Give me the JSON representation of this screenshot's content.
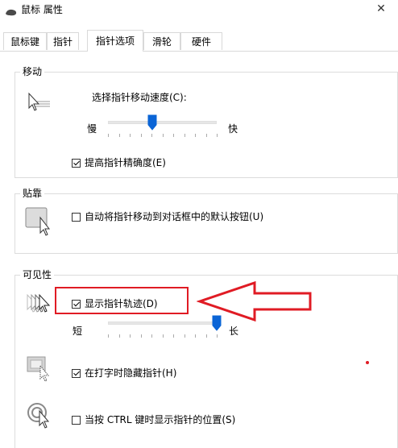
{
  "window": {
    "title": "鼠标 属性",
    "close_glyph": "✕"
  },
  "tabs": [
    {
      "label": "鼠标键",
      "active": false
    },
    {
      "label": "指针",
      "active": false
    },
    {
      "label": "指针选项",
      "active": true
    },
    {
      "label": "滑轮",
      "active": false
    },
    {
      "label": "硬件",
      "active": false
    }
  ],
  "motion": {
    "title": "移动",
    "speed_label": "选择指针移动速度(C):",
    "slow_label": "慢",
    "fast_label": "快",
    "speed_level": 0.41,
    "precision_label": "提高指针精确度(E)",
    "precision_checked": true
  },
  "snap": {
    "title": "贴靠",
    "snap_label": "自动将指针移动到对话框中的默认按钮(U)",
    "snap_checked": false
  },
  "visibility": {
    "title": "可见性",
    "trails_label": "显示指针轨迹(D)",
    "trails_checked": true,
    "short_label": "短",
    "long_label": "长",
    "trails_level": 1.0,
    "hide_label": "在打字时隐藏指针(H)",
    "hide_checked": true,
    "ctrl_label": "当按 CTRL 键时显示指针的位置(S)",
    "ctrl_checked": false
  },
  "colors": {
    "accent": "#0a64d6",
    "annotation": "#e01b24"
  },
  "icons": {
    "title": "mouse-icon",
    "motion": "pointer-speed-icon",
    "snap": "snap-to-button-icon",
    "trails": "pointer-trails-icon",
    "hide": "hide-while-typing-icon",
    "ctrl": "show-location-icon"
  }
}
